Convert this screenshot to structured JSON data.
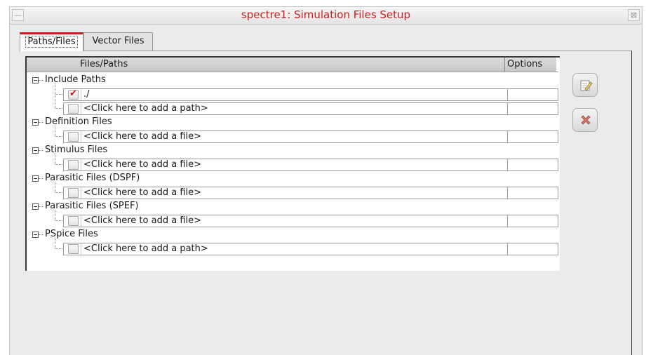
{
  "window": {
    "title": "spectre1: Simulation Files Setup",
    "minimize_glyph": "—",
    "close_glyph": "⊠"
  },
  "tabs": [
    {
      "label": "Paths/Files",
      "active": true
    },
    {
      "label": "Vector Files",
      "active": false
    }
  ],
  "table": {
    "columns": {
      "files": "Files/Paths",
      "options": "Options"
    },
    "groups": [
      {
        "label": "Include Paths",
        "children": [
          {
            "checked": true,
            "text": "./",
            "options": ""
          },
          {
            "checked": false,
            "text": "<Click here to add a path>",
            "options": ""
          }
        ]
      },
      {
        "label": "Definition Files",
        "children": [
          {
            "checked": false,
            "text": "<Click here to add a file>",
            "options": ""
          }
        ]
      },
      {
        "label": "Stimulus Files",
        "children": [
          {
            "checked": false,
            "text": "<Click here to add a file>",
            "options": ""
          }
        ]
      },
      {
        "label": "Parasitic Files (DSPF)",
        "children": [
          {
            "checked": false,
            "text": "<Click here to add a file>",
            "options": ""
          }
        ]
      },
      {
        "label": "Parasitic Files (SPEF)",
        "children": [
          {
            "checked": false,
            "text": "<Click here to add a file>",
            "options": ""
          }
        ]
      },
      {
        "label": "PSpice Files",
        "children": [
          {
            "checked": false,
            "text": "<Click here to add a path>",
            "options": ""
          }
        ]
      }
    ]
  },
  "side_buttons": [
    {
      "name": "edit",
      "icon": "edit-icon"
    },
    {
      "name": "delete",
      "icon": "delete-icon"
    }
  ],
  "colors": {
    "title_text": "#c81e1e",
    "active_tab_accent": "#c81e1e",
    "checkmark": "#d01818"
  }
}
